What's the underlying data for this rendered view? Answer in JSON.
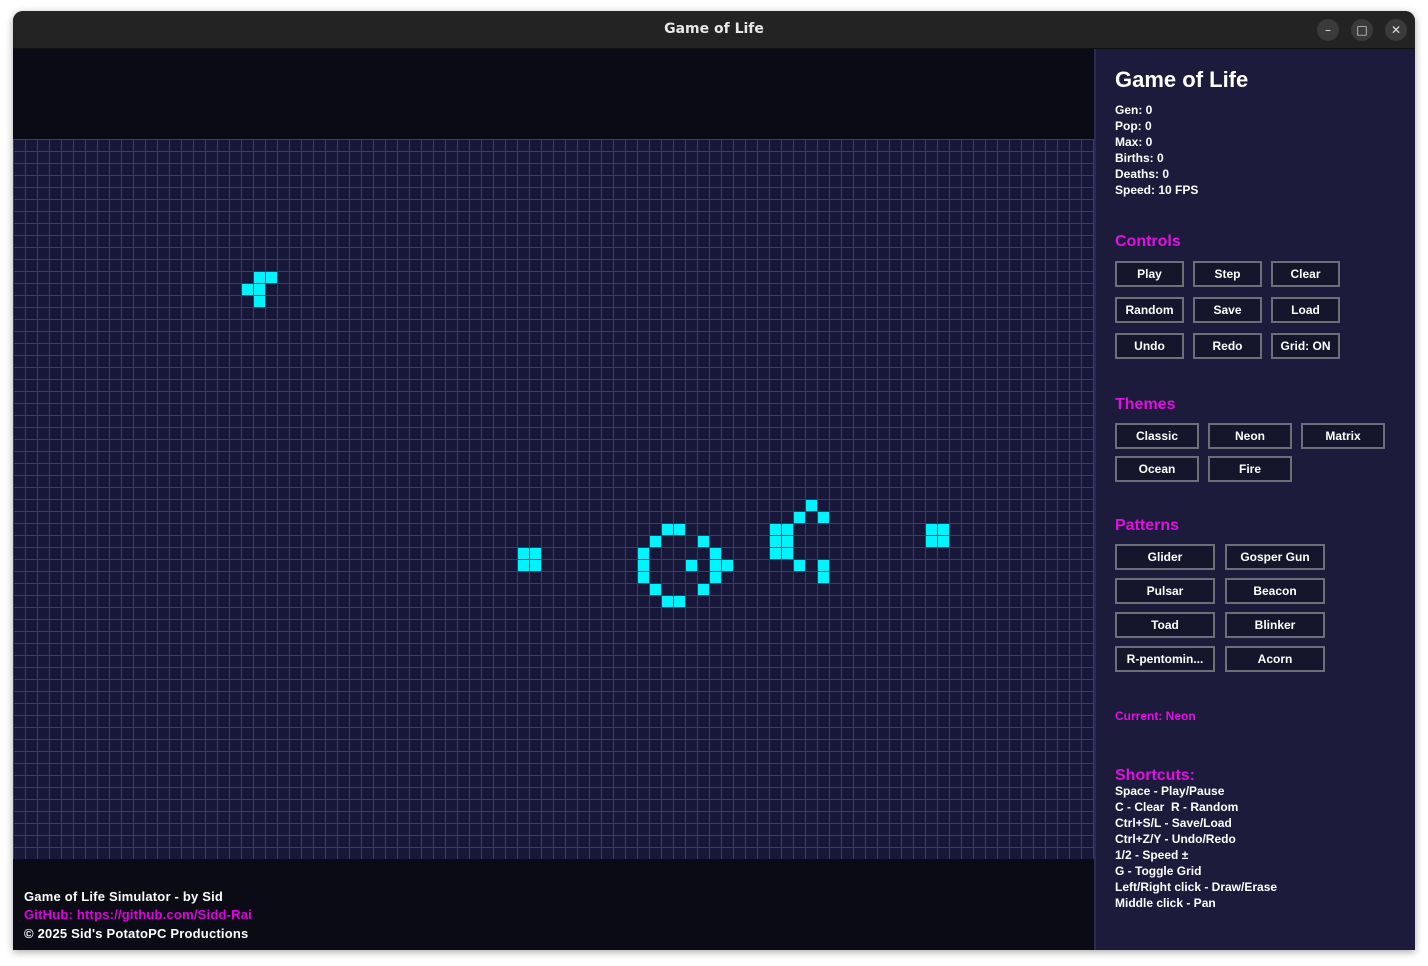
{
  "window": {
    "title": "Game of Life",
    "minimize_icon": "minimize-icon",
    "maximize_icon": "maximize-icon",
    "close_icon": "close-icon"
  },
  "colors": {
    "cell": "#00f4ff",
    "grid_bg": "#17173a",
    "grid_line": "#3a3a7a",
    "accent": "#e010e0",
    "panel_bg": "#1d1b3c"
  },
  "footer": {
    "credit": "Game of Life Simulator - by Sid",
    "github": "GitHub: https://github.com/Sidd-Rai",
    "copyright": "© 2025 Sid's PotatoPC Productions"
  },
  "panel": {
    "title": "Game of Life",
    "stats": [
      "Gen: 0",
      "Pop: 0",
      "Max: 0",
      "Births: 0",
      "Deaths: 0",
      "Speed: 10 FPS"
    ],
    "controls_heading": "Controls",
    "controls": [
      "Play",
      "Step",
      "Clear",
      "Random",
      "Save",
      "Load",
      "Undo",
      "Redo",
      "Grid: ON"
    ],
    "themes_heading": "Themes",
    "themes": [
      "Classic",
      "Neon",
      "Matrix",
      "Ocean",
      "Fire"
    ],
    "patterns_heading": "Patterns",
    "patterns": [
      "Glider",
      "Gosper Gun",
      "Pulsar",
      "Beacon",
      "Toad",
      "Blinker",
      "R-pentomin...",
      "Acorn"
    ],
    "current_theme": "Current: Neon",
    "shortcuts_heading": "Shortcuts:",
    "shortcuts": [
      "Space - Play/Pause",
      "C - Clear  R - Random",
      "Ctrl+S/L - Save/Load",
      "Ctrl+Z/Y - Undo/Redo",
      "1/2 - Speed ±",
      "G - Toggle Grid",
      "Left/Right click - Draw/Erase",
      "Middle click - Pan"
    ]
  }
}
